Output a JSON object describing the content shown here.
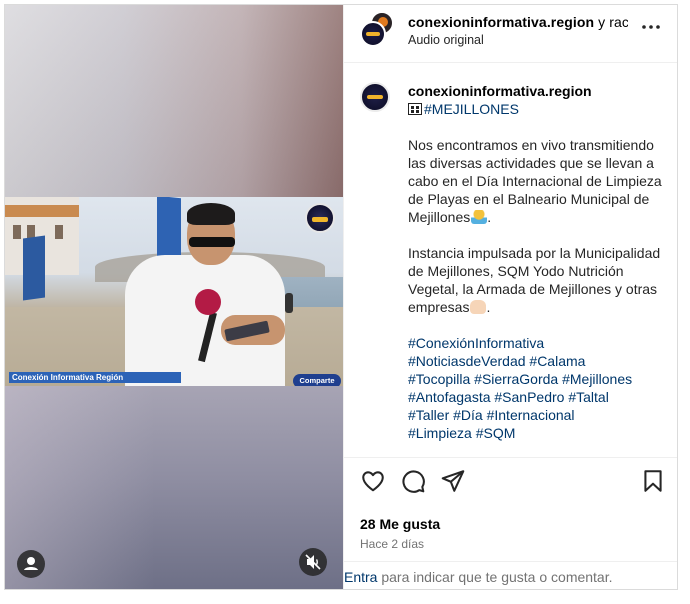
{
  "header": {
    "username": "conexioninformativa.region",
    "username_suffix": " y rac",
    "audio_label": "Audio original",
    "more_icon": "more-horizontal-icon"
  },
  "video": {
    "caption_bar": "Conexión Informativa Región",
    "share_label": "Comparte",
    "avatar_icon": "user-avatar-icon",
    "mute_icon": "muted-speaker-icon"
  },
  "caption": {
    "username": "conexioninformativa.region",
    "title_tag": "#MEJILLONES",
    "para1": "Nos encontramos en vivo transmitiendo las diversas actividades que se llevan a cabo en el Día Internacional de Limpieza de Playas en el Balneario Municipal de Mejillones",
    "para2": "Instancia impulsada por la Municipalidad de Mejillones, SQM Yodo Nutrición Vegetal, la Armada de Mejillones y otras empresas",
    "hashtags": [
      "#ConexiónInformativa",
      "#NoticiasdeVerdad #Calama",
      "#Tocopilla #SierraGorda #Mejillones",
      "#Antofagasta #SanPedro #Taltal",
      "#Taller #Día #Internacional",
      "#Limpieza #SQM"
    ]
  },
  "actions": {
    "like_icon": "heart-icon",
    "comment_icon": "comment-bubble-icon",
    "share_icon": "paper-plane-icon",
    "save_icon": "bookmark-icon",
    "likes_text": "28 Me gusta",
    "time_text": "Hace 2 días"
  },
  "comment_bar": {
    "enter_link": "Entra",
    "prompt": " para indicar que te gusta o comentar."
  },
  "colors": {
    "link": "#00376b",
    "muted": "#737373",
    "border": "#dbdbdb"
  }
}
